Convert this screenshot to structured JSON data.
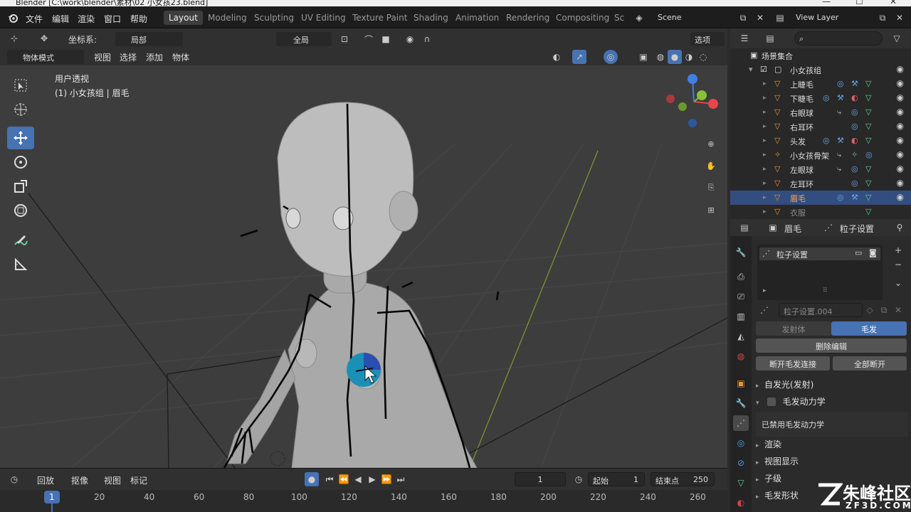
{
  "window": {
    "title": "Blender [C:\\work\\blender\\素材\\02 小女孩23.blend]"
  },
  "menu": [
    "文件",
    "编辑",
    "渲染",
    "窗口",
    "帮助"
  ],
  "workspaces": [
    "Layout",
    "Modeling",
    "Sculpting",
    "UV Editing",
    "Texture Paint",
    "Shading",
    "Animation",
    "Rendering",
    "Compositing",
    "Sc"
  ],
  "scene": {
    "label": "Scene"
  },
  "view_layer": {
    "label": "View Layer"
  },
  "tool_header": {
    "coord_label": "坐标系:",
    "coord_value": "局部",
    "pivot_value": "全局",
    "options_label": "选项"
  },
  "view3d_header": {
    "mode": "物体模式",
    "view": "视图",
    "select": "选择",
    "add": "添加",
    "object": "物体"
  },
  "viewport": {
    "perspective": "用户透视",
    "active_info": "(1) 小女孩组 | 眉毛"
  },
  "timeline": {
    "playback": "回放",
    "keying": "抠像",
    "view": "视图",
    "marker": "标记",
    "current_frame": "1",
    "start_label": "起始",
    "start": "1",
    "end_label": "结束点",
    "end": "250",
    "ticks": [
      "1",
      "20",
      "40",
      "60",
      "80",
      "100",
      "120",
      "140",
      "160",
      "180",
      "200",
      "220",
      "240",
      "260"
    ]
  },
  "outliner": {
    "collection": "场景集合",
    "group": "小女孩组",
    "items": [
      {
        "name": "上睫毛"
      },
      {
        "name": "下睫毛"
      },
      {
        "name": "右眼球"
      },
      {
        "name": "右耳环"
      },
      {
        "name": "头发"
      },
      {
        "name": "小女孩骨架"
      },
      {
        "name": "左眼球"
      },
      {
        "name": "左耳环"
      },
      {
        "name": "眉毛"
      },
      {
        "name": "衣服"
      }
    ]
  },
  "properties": {
    "object_name": "眉毛",
    "context": "粒子设置",
    "particle_list_item": "粒子设置",
    "particle_settings_name": "粒子设置.004",
    "tab_emitter": "发射体",
    "tab_hair": "毛发",
    "delete_edit": "删除编辑",
    "disconnect_hair": "断开毛发连接",
    "disconnect_all": "全部断开",
    "panels": {
      "emission": "自发光(发射)",
      "hair_dynamics": "毛发动力学",
      "hair_dynamics_disabled": "已禁用毛发动力学",
      "render": "渲染",
      "viewport_display": "视图显示",
      "children": "子级",
      "hair_shape": "毛发形状"
    }
  },
  "watermark": {
    "brand": "朱峰社区",
    "site": "ZF3D.COM"
  },
  "colors": {
    "accent": "#4772b3",
    "selected_row": "#334d80",
    "header_bg": "#303030",
    "viewport_bg": "#3d3d3d",
    "object_orange": "#e7953c",
    "data_green": "#5fd68f"
  }
}
